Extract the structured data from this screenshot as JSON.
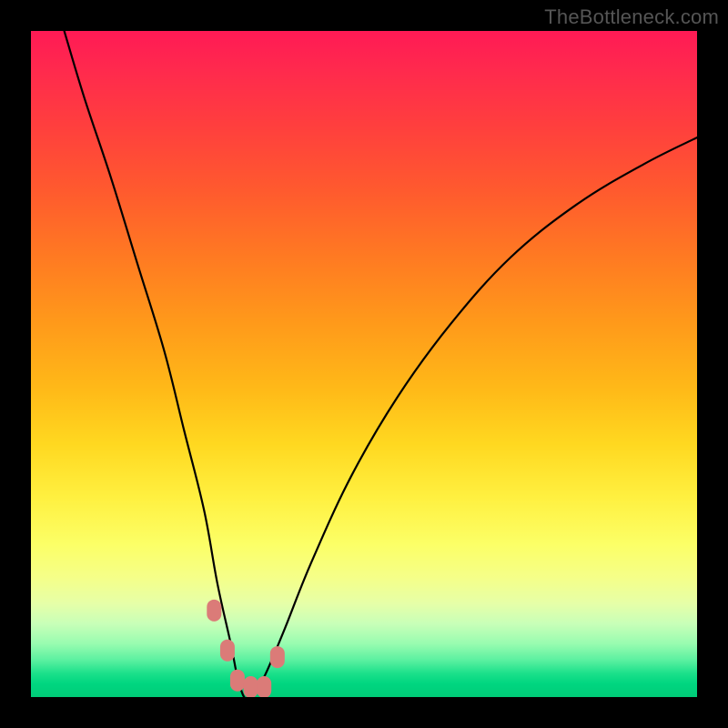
{
  "watermark": "TheBottleneck.com",
  "chart_data": {
    "type": "line",
    "title": "",
    "xlabel": "",
    "ylabel": "",
    "xlim": [
      0,
      100
    ],
    "ylim": [
      0,
      100
    ],
    "series": [
      {
        "name": "bottleneck-curve",
        "x": [
          5,
          8,
          12,
          16,
          20,
          23,
          26,
          28,
          30,
          31,
          32,
          33,
          35,
          38,
          42,
          48,
          55,
          63,
          72,
          82,
          92,
          100
        ],
        "values": [
          100,
          90,
          78,
          65,
          52,
          40,
          28,
          17,
          8,
          3,
          0,
          0,
          3,
          10,
          20,
          33,
          45,
          56,
          66,
          74,
          80,
          84
        ]
      }
    ],
    "markers": {
      "name": "highlight-points",
      "x": [
        27.5,
        29.5,
        31.0,
        33.0,
        35.0,
        37.0
      ],
      "values": [
        13.0,
        7.0,
        2.5,
        1.5,
        1.5,
        6.0
      ]
    },
    "background_gradient": {
      "top": "#ff1a55",
      "mid": "#ffd820",
      "bottom": "#00cc78"
    }
  }
}
